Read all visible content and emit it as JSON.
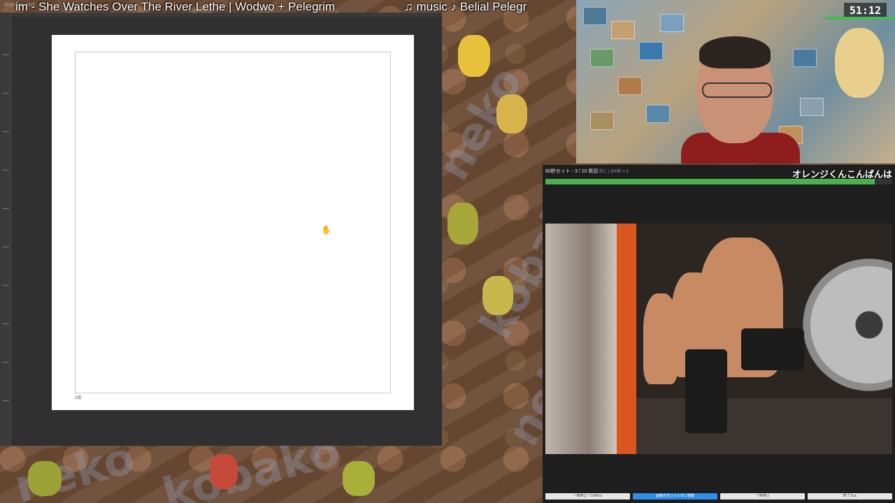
{
  "stream": {
    "now_playing": "im - She Watches Over The River Lethe | Wodwo + Pelegrim",
    "music_label": "♫ music ♪ Belial Pelegr",
    "timer": "51:12"
  },
  "editor": {
    "doc_tab": "drawing.psd",
    "frame_label": "1班"
  },
  "app": {
    "progress_label": "60秒セット - 3 / 10 枚目",
    "sub_label": "次に | 300秒 x 3",
    "greeting": "オレンジくんこんばんは",
    "progress_fraction": 0.95,
    "progress_color": "#4caf50",
    "buttons": {
      "prev": "一時停止 / CtrlArro",
      "open_folder": "画像を別フォルダに移動",
      "pause": "一時停止",
      "quit": "終了 Esc"
    },
    "primary_color": "#2f8ee8"
  },
  "background": {
    "words": [
      "neko",
      "kobako",
      "neko",
      "kobako",
      "neko"
    ]
  }
}
